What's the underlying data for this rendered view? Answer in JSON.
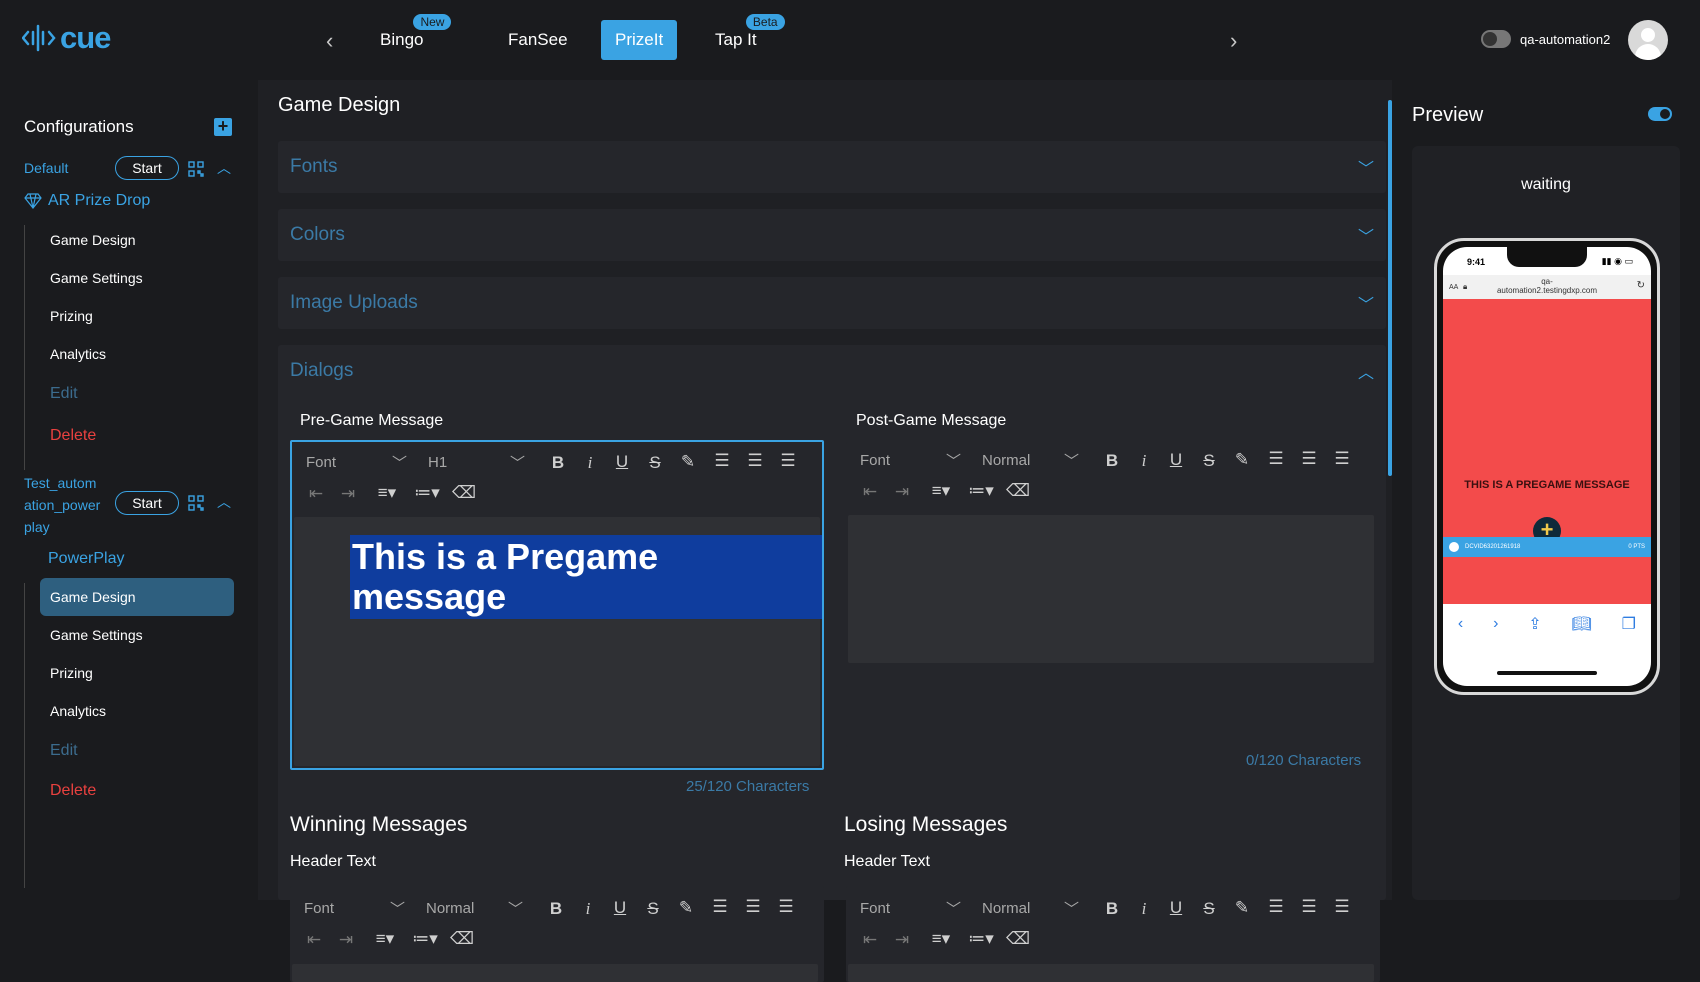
{
  "header": {
    "logo_text": "cue",
    "tabs": [
      {
        "label": "Bingo",
        "badge": "New"
      },
      {
        "label": "FanSee",
        "badge": ""
      },
      {
        "label": "PrizeIt",
        "badge": ""
      },
      {
        "label": "Tap It",
        "badge": "Beta"
      }
    ],
    "active_tab": "PrizeIt",
    "username": "qa-automation2"
  },
  "sidebar": {
    "title": "Configurations",
    "configs": [
      {
        "name": "Default",
        "start_label": "Start",
        "game": "AR Prize Drop",
        "items": [
          "Game Design",
          "Game Settings",
          "Prizing",
          "Analytics"
        ],
        "edit_label": "Edit",
        "delete_label": "Delete"
      },
      {
        "name_lines": [
          "Test_autom",
          "ation_power",
          "play"
        ],
        "start_label": "Start",
        "game": "PowerPlay",
        "items": [
          "Game Design",
          "Game Settings",
          "Prizing",
          "Analytics"
        ],
        "edit_label": "Edit",
        "delete_label": "Delete",
        "selected_item": "Game Design"
      }
    ]
  },
  "main": {
    "title": "Game Design",
    "accordions": [
      "Fonts",
      "Colors",
      "Image Uploads",
      "Dialogs"
    ],
    "pregame": {
      "label": "Pre-Game Message",
      "font_placeholder": "Font",
      "heading": "H1",
      "content": "This is a Pregame message",
      "count": "25/120 Characters"
    },
    "postgame": {
      "label": "Post-Game Message",
      "font_placeholder": "Font",
      "heading": "Normal",
      "count": "0/120 Characters"
    },
    "winning": {
      "title": "Winning Messages",
      "header_label": "Header Text",
      "font_placeholder": "Font",
      "heading": "Normal"
    },
    "losing": {
      "title": "Losing Messages",
      "header_label": "Header Text",
      "font_placeholder": "Font",
      "heading": "Normal"
    }
  },
  "preview": {
    "title": "Preview",
    "status": "waiting",
    "phone": {
      "time": "9:41",
      "url_line1": "qa-",
      "url_line2": "automation2.testingdxp.com",
      "aa": "AA",
      "message": "This is a Pregame message",
      "device_id": "DCVID63201261918",
      "points": "0 PTS"
    }
  },
  "colors": {
    "accent": "#3aa3e3",
    "delete": "#e8413f",
    "phone_bg": "#f34b4b"
  }
}
